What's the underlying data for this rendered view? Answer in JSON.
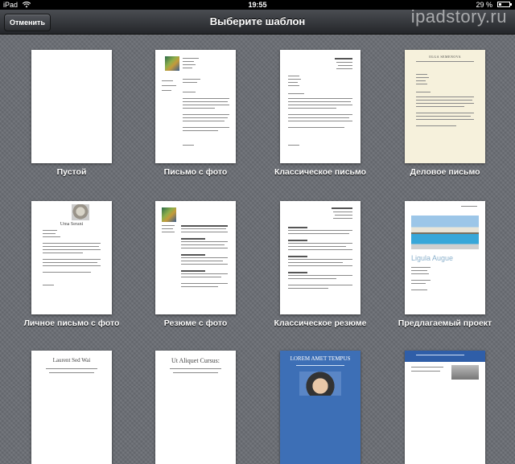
{
  "status_bar": {
    "carrier": "iPad",
    "time": "19:55",
    "battery": "29 %",
    "battery_level": 0.29
  },
  "nav": {
    "title": "Выберите шаблон",
    "cancel_label": "Отменить"
  },
  "watermark": "ipadstory.ru",
  "templates": [
    {
      "label": "Пустой"
    },
    {
      "label": "Письмо с фото"
    },
    {
      "label": "Классическое письмо"
    },
    {
      "label": "Деловое письмо"
    },
    {
      "label": "Личное письмо с фото"
    },
    {
      "label": "Резюме с фото"
    },
    {
      "label": "Классическое резюме"
    },
    {
      "label": "Предлагаемый проект"
    }
  ],
  "partial_templates": [
    {
      "title": "Laurent Sed Wai"
    },
    {
      "title": "Ut Aliquet Cursus:"
    },
    {
      "title": "LOREM AMET TEMPUS"
    },
    {
      "title": ""
    }
  ],
  "thumb_text": {
    "business_header": "OLGA SEMENOVA",
    "personal_name": "Uma Serani",
    "project_title": "Ligula Augue",
    "classic_name": "Anna Semenova"
  }
}
